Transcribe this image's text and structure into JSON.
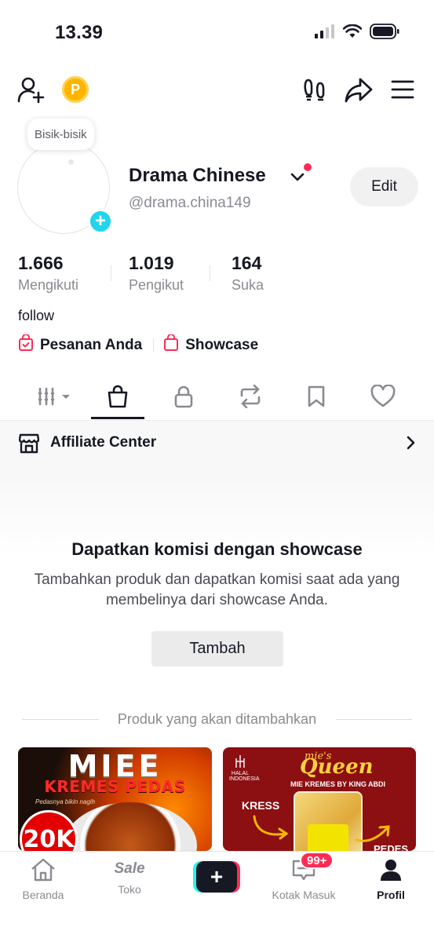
{
  "status_bar": {
    "time": "13.39"
  },
  "profile": {
    "note_bubble": "Bisik-bisik",
    "display_name": "Drama Chinese",
    "username": "@drama.china149",
    "edit_label": "Edit",
    "bio": "follow",
    "stats": [
      {
        "value": "1.666",
        "label": "Mengikuti"
      },
      {
        "value": "1.019",
        "label": "Pengikut"
      },
      {
        "value": "164",
        "label": "Suka"
      }
    ],
    "links": [
      {
        "label": "Pesanan Anda",
        "icon": "order-bag-icon"
      },
      {
        "label": "Showcase",
        "icon": "shopping-bag-icon"
      }
    ]
  },
  "tabs": [
    {
      "icon": "grid-icon",
      "active": false
    },
    {
      "icon": "shopping-bag-icon",
      "active": true
    },
    {
      "icon": "lock-icon",
      "active": false
    },
    {
      "icon": "repost-icon",
      "active": false
    },
    {
      "icon": "bookmark-icon",
      "active": false
    },
    {
      "icon": "heart-icon",
      "active": false
    }
  ],
  "affiliate": {
    "label": "Affiliate Center"
  },
  "showcase": {
    "title": "Dapatkan komisi dengan showcase",
    "description": "Tambahkan produk dan dapatkan komisi saat ada yang membelinya dari showcase Anda.",
    "add_label": "Tambah",
    "divider_text": "Produk yang akan ditambahkan"
  },
  "products": [
    {
      "headline": "MIEE",
      "subline": "KREMES PEDAS",
      "tagline": "Pedasnya bikin nagih",
      "price_badge": "20K"
    },
    {
      "brand_small": "mie's",
      "brand": "Queen",
      "byline": "MIE KREMES BY KING ABDI",
      "callout_left": "KRESS",
      "callout_right": "PEDES",
      "halal": "HALAL INDONESIA"
    }
  ],
  "bottom_nav": {
    "home": "Beranda",
    "shop": "Toko",
    "shop_badge": "Sale",
    "inbox": "Kotak Masuk",
    "inbox_badge": "99+",
    "profile": "Profil"
  },
  "colors": {
    "accent_red": "#fe2c55",
    "accent_cyan": "#20d5ec",
    "text_primary": "#161823",
    "text_secondary": "#8a8b91",
    "coin": "#ffb400"
  }
}
